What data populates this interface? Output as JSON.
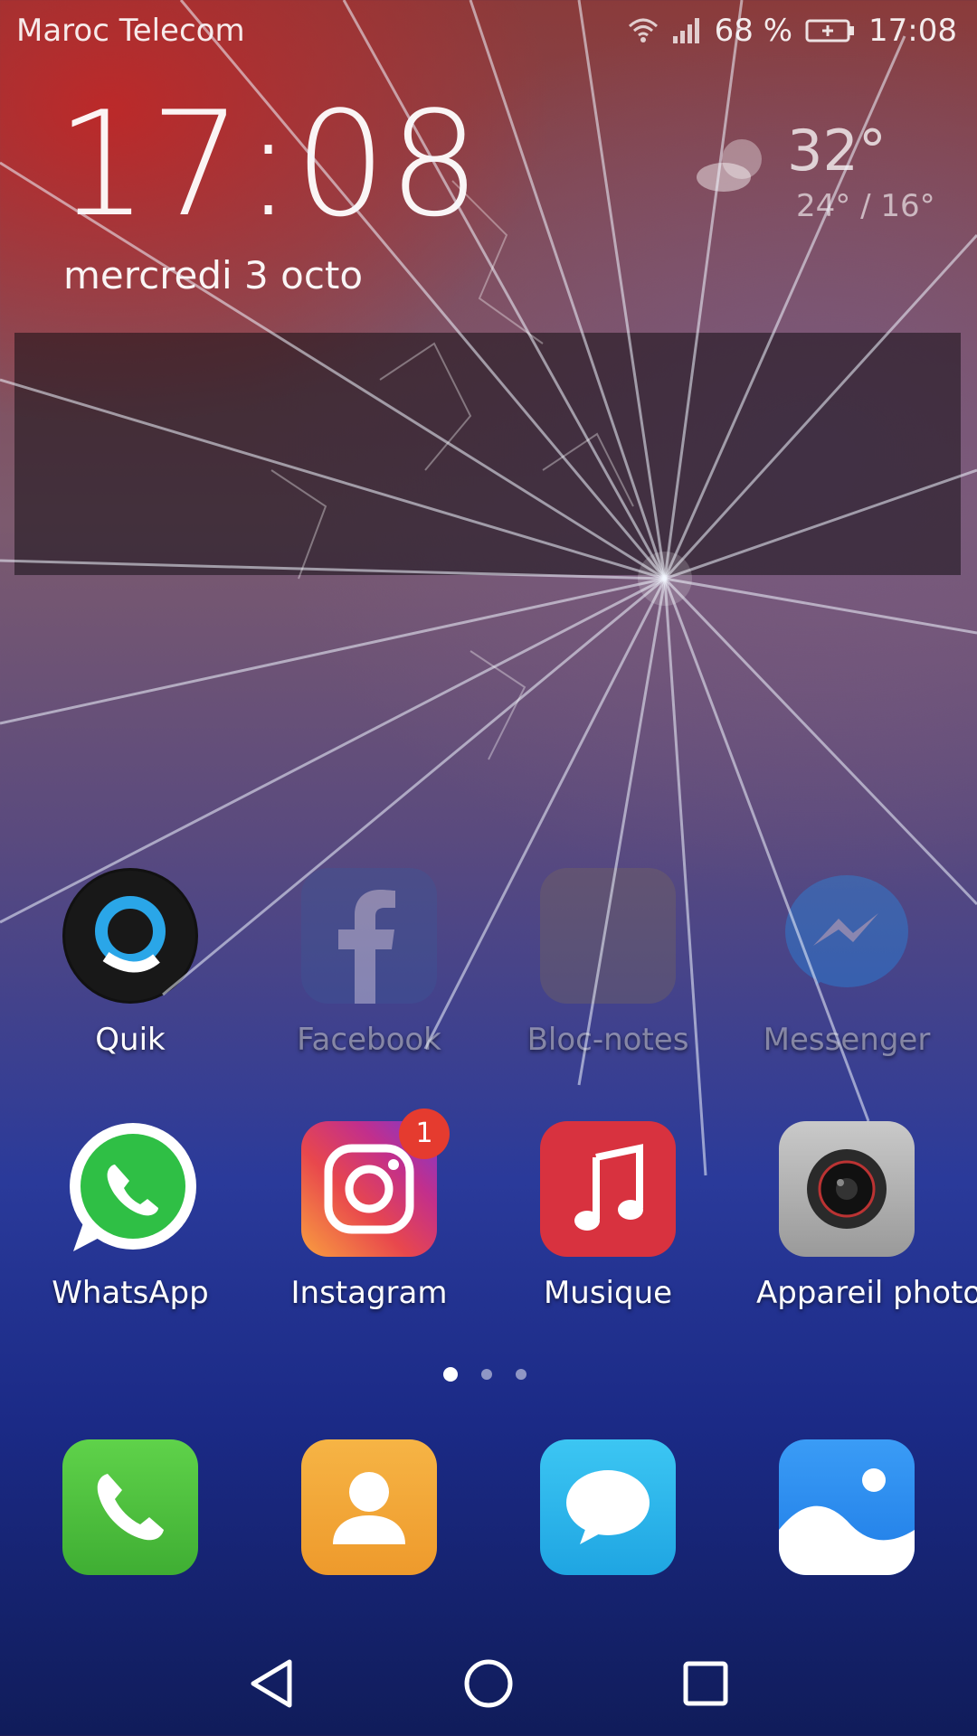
{
  "status_bar": {
    "carrier": "Maroc Telecom",
    "battery_percent": "68 %",
    "time": "17:08"
  },
  "lockclock": {
    "time": "17:08",
    "date": "mercredi 3 octo"
  },
  "weather": {
    "temperature": "32°",
    "range": "24° / 16°",
    "icon": "partly-cloudy-icon"
  },
  "apps_row1": [
    {
      "label": "Quik",
      "icon": "quik-icon",
      "faded": false
    },
    {
      "label": "Facebook",
      "icon": "facebook-icon",
      "faded": true
    },
    {
      "label": "Bloc-notes",
      "icon": "notes-icon",
      "faded": true
    },
    {
      "label": "Messenger",
      "icon": "messenger-icon",
      "faded": true
    }
  ],
  "apps_row2": [
    {
      "label": "WhatsApp",
      "icon": "whatsapp-icon"
    },
    {
      "label": "Instagram",
      "icon": "instagram-icon",
      "badge": "1"
    },
    {
      "label": "Musique",
      "icon": "music-icon"
    },
    {
      "label": "Appareil photo",
      "icon": "camera-icon"
    }
  ],
  "page_indicator": {
    "pages": 3,
    "current": 1
  },
  "dock": [
    {
      "icon": "phone-icon"
    },
    {
      "icon": "contacts-icon"
    },
    {
      "icon": "messages-icon"
    },
    {
      "icon": "gallery-icon"
    }
  ],
  "nav": {
    "back": "back-icon",
    "home": "home-icon",
    "recents": "recents-icon"
  },
  "colors": {
    "badge": "#e53b2f",
    "whatsapp": "#25d366",
    "music": "#d8323f",
    "phone": "#4cbf3c",
    "contacts": "#f3a53a",
    "messages": "#2fb4ea",
    "gallery": "#2f8ff0"
  }
}
